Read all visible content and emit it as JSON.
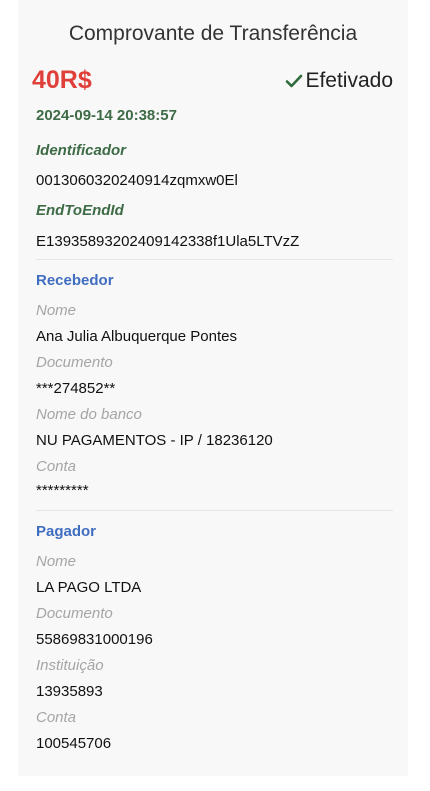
{
  "receipt": {
    "title": "Comprovante de Transferência",
    "amount": "40R$",
    "status": "Efetivado",
    "status_icon": "check-icon",
    "datetime": "2024-09-14 20:38:57",
    "identificador_label": "Identificador",
    "identificador_value": "0013060320240914zqmxw0El",
    "endtoend_label": "EndToEndId",
    "endtoend_value": "E13935893202409142338f1Ula5LTVzZ"
  },
  "recebedor": {
    "title": "Recebedor",
    "nome_label": "Nome",
    "nome_value": "Ana Julia Albuquerque Pontes",
    "documento_label": "Documento",
    "documento_value": "***274852**",
    "banco_label": "Nome do banco",
    "banco_value": "NU PAGAMENTOS - IP / 18236120",
    "conta_label": "Conta",
    "conta_value": "*********"
  },
  "pagador": {
    "title": "Pagador",
    "nome_label": "Nome",
    "nome_value": "LA PAGO LTDA",
    "documento_label": "Documento",
    "documento_value": "55869831000196",
    "instituicao_label": "Instituição",
    "instituicao_value": "13935893",
    "conta_label": "Conta",
    "conta_value": "100545706"
  },
  "colors": {
    "amount": "#e0403a",
    "green_label": "#3e6b46",
    "section_title": "#3f6dc0",
    "muted_label": "#a5a5a5",
    "check": "#2e6b3a"
  }
}
